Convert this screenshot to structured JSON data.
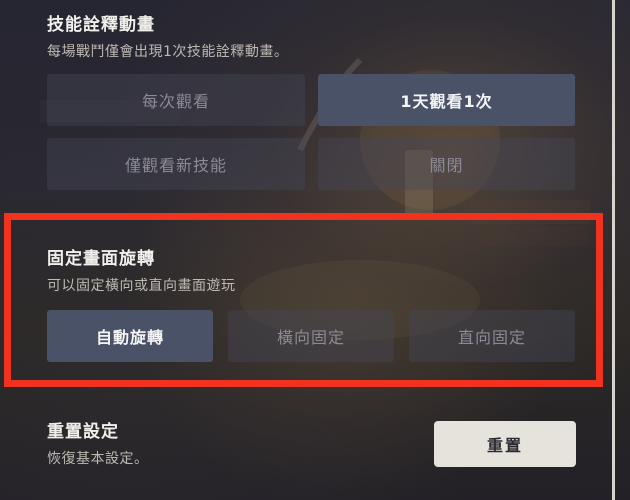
{
  "skill_animation": {
    "title": "技能詮釋動畫",
    "description": "每場戰鬥僅會出現1次技能詮釋動畫。",
    "options": [
      "每次觀看",
      "1天觀看1次",
      "僅觀看新技能",
      "關閉"
    ],
    "selected": "1天觀看1次"
  },
  "screen_rotation": {
    "title": "固定畫面旋轉",
    "description": "可以固定橫向或直向畫面遊玩",
    "options": [
      "自動旋轉",
      "橫向固定",
      "直向固定"
    ],
    "selected": "自動旋轉",
    "highlight_color": "#f0321e"
  },
  "reset": {
    "title": "重置設定",
    "description": "恢復基本設定。",
    "button_label": "重置"
  }
}
